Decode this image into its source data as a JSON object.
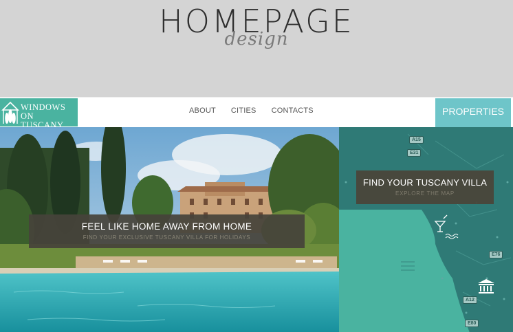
{
  "heading": {
    "title": "HOMEPAGE",
    "subtitle": "design"
  },
  "nav": {
    "logo_line1": "WINDOWS",
    "logo_line2": "ON TUSCANY",
    "links": [
      "ABOUT",
      "CITIES",
      "CONTACTS"
    ],
    "properties_label": "PROPERTIES"
  },
  "hero": {
    "title": "FEEL LIKE HOME AWAY FROM HOME",
    "subtitle": "FIND YOUR EXCLUSIVE TUSCANY VILLA FOR HOLIDAYS"
  },
  "map": {
    "title": "FIND YOUR TUSCANY VILLA",
    "subtitle": "EXPLORE THE MAP",
    "road_labels": [
      "A15",
      "E31",
      "E76",
      "A12",
      "E80"
    ],
    "icons": [
      "cocktail-icon",
      "waves-icon",
      "museum-icon"
    ]
  },
  "colors": {
    "brand_teal": "#4ab3a0",
    "properties_bg": "#6ec5c9",
    "panel_bg": "#46433a",
    "sea": "#4ab3a0",
    "land": "#2f7a76"
  }
}
